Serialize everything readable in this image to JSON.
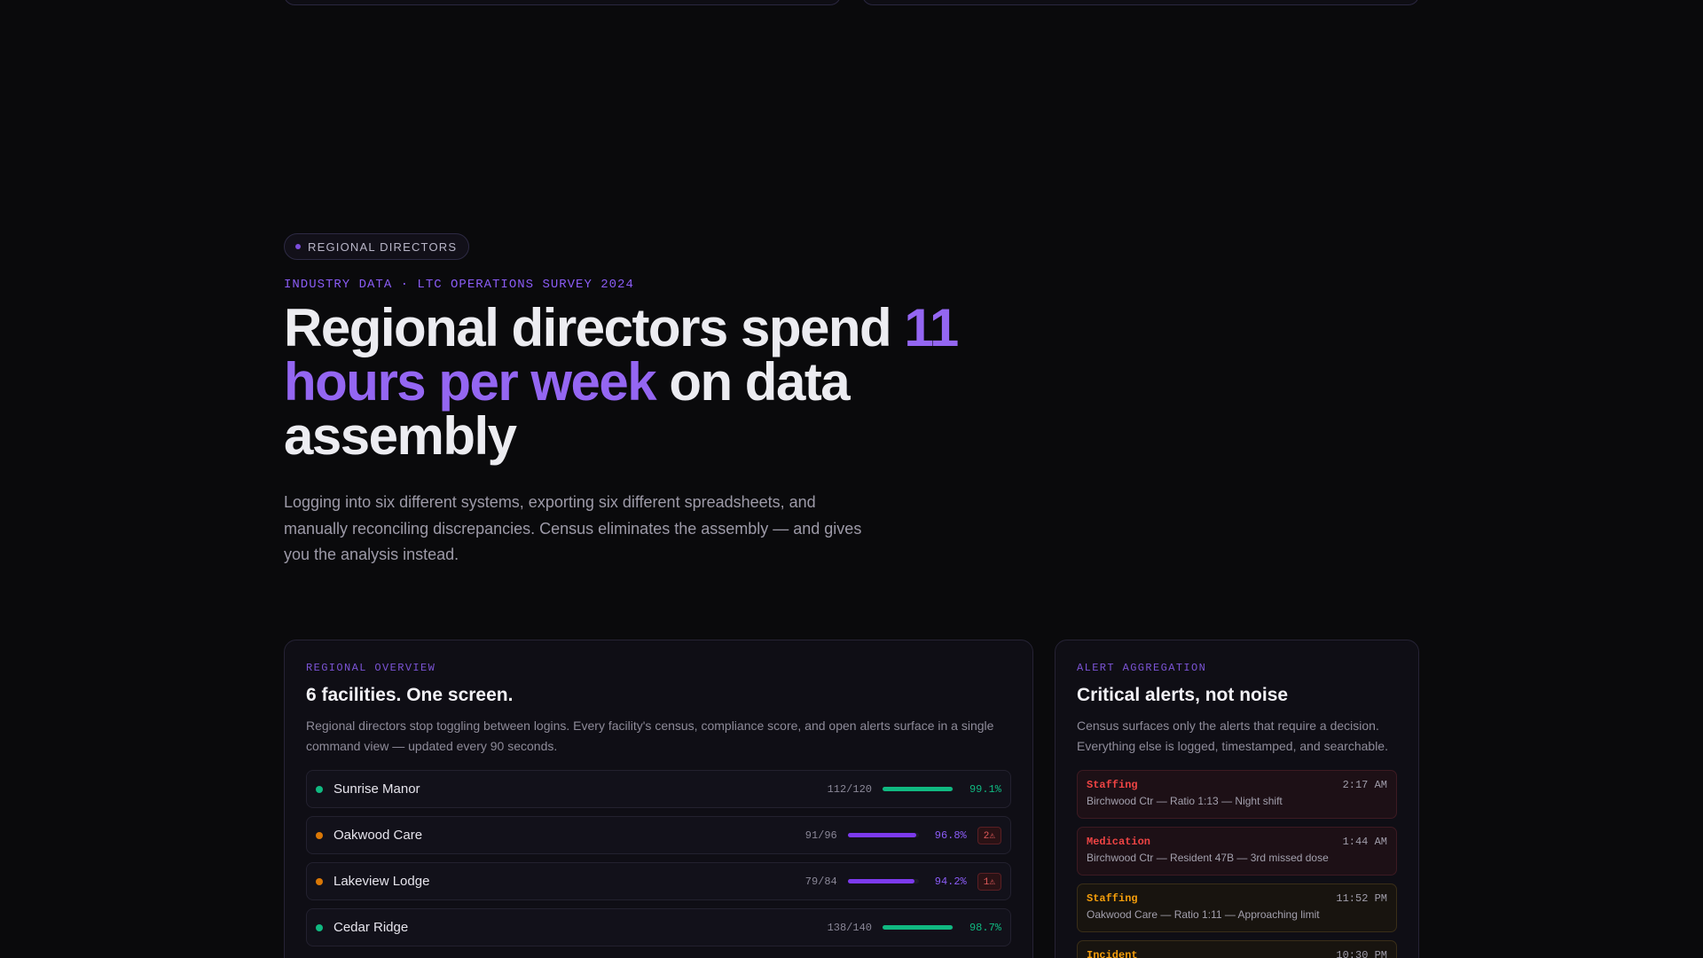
{
  "hero": {
    "pill": "REGIONAL DIRECTORS",
    "eyebrow": "INDUSTRY DATA · LTC OPERATIONS SURVEY 2024",
    "headline_pre": "Regional directors spend ",
    "headline_accent": "11 hours per week",
    "headline_post": " on data assembly",
    "lede": "Logging into six different systems, exporting six different spreadsheets, and manually reconciling discrepancies. Census eliminates the assembly — and gives you the analysis instead."
  },
  "overview": {
    "kicker": "REGIONAL OVERVIEW",
    "title": "6 facilities. One screen.",
    "desc": "Regional directors stop toggling between logins. Every facility's census, compliance score, and open alerts surface in a single command view — updated every 90 seconds.",
    "facilities": [
      {
        "name": "Sunrise Manor",
        "census": "112/120",
        "score": "99.1%",
        "fill": 0.991,
        "status_color": "#10b981",
        "bar_color": "#10b981",
        "score_color": "#10b981",
        "alerts": ""
      },
      {
        "name": "Oakwood Care",
        "census": "91/96",
        "score": "96.8%",
        "fill": 0.968,
        "status_color": "#d97706",
        "bar_color": "#7c3aed",
        "score_color": "#8b5cf6",
        "alerts": "2⚠"
      },
      {
        "name": "Lakeview Lodge",
        "census": "79/84",
        "score": "94.2%",
        "fill": 0.942,
        "status_color": "#d97706",
        "bar_color": "#7c3aed",
        "score_color": "#8b5cf6",
        "alerts": "1⚠"
      },
      {
        "name": "Cedar Ridge",
        "census": "138/140",
        "score": "98.7%",
        "fill": 0.987,
        "status_color": "#10b981",
        "bar_color": "#10b981",
        "score_color": "#10b981",
        "alerts": ""
      }
    ]
  },
  "alerts": {
    "kicker": "ALERT AGGREGATION",
    "title": "Critical alerts, not noise",
    "desc": "Census surfaces only the alerts that require a decision. Everything else is logged, timestamped, and searchable.",
    "items": [
      {
        "type": "Staffing",
        "time": "2:17 AM",
        "detail": "Birchwood Ctr — Ratio 1:13 — Night shift",
        "severity": "red",
        "type_color": "#ef4444"
      },
      {
        "type": "Medication",
        "time": "1:44 AM",
        "detail": "Birchwood Ctr — Resident 47B — 3rd missed dose",
        "severity": "red",
        "type_color": "#ef4444"
      },
      {
        "type": "Staffing",
        "time": "11:52 PM",
        "detail": "Oakwood Care — Ratio 1:11 — Approaching limit",
        "severity": "amber",
        "type_color": "#f59e0b"
      },
      {
        "type": "Incident",
        "time": "10:30 PM",
        "detail": "",
        "severity": "amber",
        "type_color": "#f59e0b"
      }
    ]
  }
}
